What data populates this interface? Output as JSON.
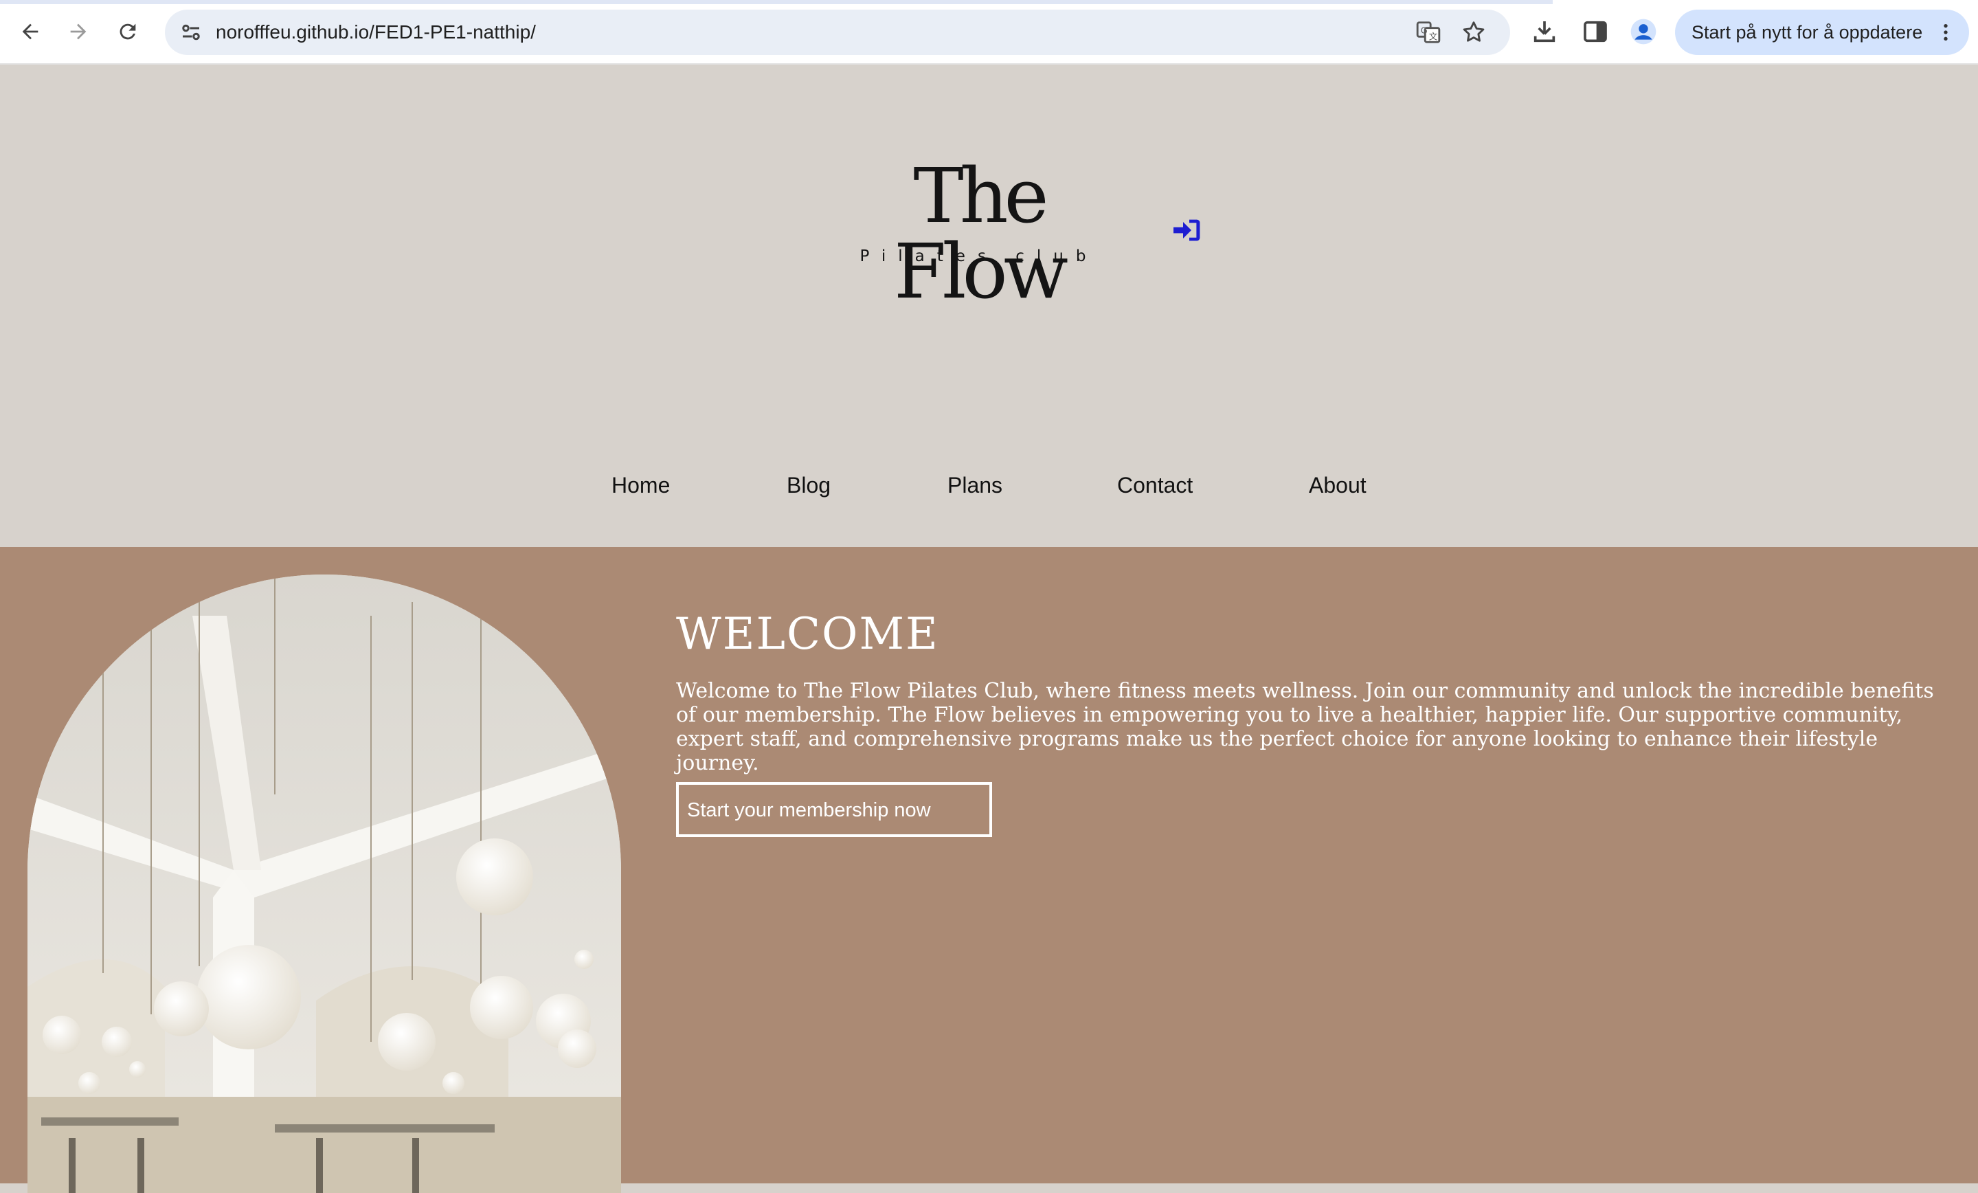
{
  "browser": {
    "url": "norofffeu.github.io/FED1-PE1-natthip/",
    "update_label": "Start på nytt for å oppdatere",
    "icons": [
      "back-icon",
      "forward-icon",
      "reload-icon",
      "site-info-icon",
      "translate-icon",
      "bookmark-star-icon",
      "download-icon",
      "side-panel-icon",
      "profile-icon",
      "more-icon"
    ]
  },
  "header": {
    "logo_title": "The Flow",
    "logo_subtitle": "Pilates club",
    "login_icon": "sign-in-icon"
  },
  "nav": {
    "items": [
      {
        "label": "Home"
      },
      {
        "label": "Blog"
      },
      {
        "label": "Plans"
      },
      {
        "label": "Contact"
      },
      {
        "label": "About"
      }
    ]
  },
  "hero": {
    "title": "WELCOME",
    "text": "Welcome to The Flow Pilates Club, where fitness meets wellness. Join our community and unlock the incredible benefits of our membership. The Flow believes in empowering you to live a healthier, happier life. Our supportive community, expert staff, and comprehensive programs make us the perfect choice for anyone looking to enhance their lifestyle journey.",
    "cta_label": "Start your membership now"
  },
  "colors": {
    "header_bg": "#d7d2cc",
    "hero_bg": "#ab8a74",
    "login_icon": "#1d1dd1",
    "update_pill": "#d3e3fd"
  }
}
